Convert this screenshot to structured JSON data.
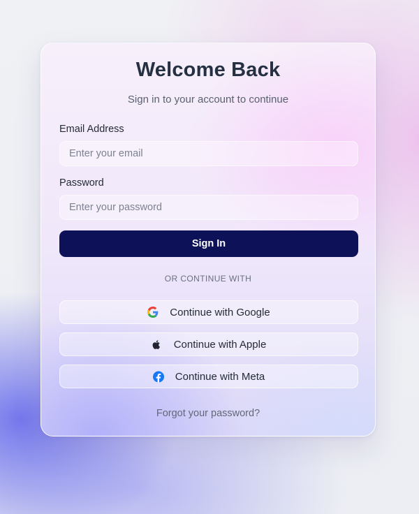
{
  "header": {
    "title": "Welcome Back",
    "subtitle": "Sign in to your account to continue"
  },
  "form": {
    "email_label": "Email Address",
    "email_placeholder": "Enter your email",
    "email_value": "",
    "password_label": "Password",
    "password_placeholder": "Enter your password",
    "password_value": "",
    "submit_label": "Sign In"
  },
  "divider": {
    "text": "OR CONTINUE WITH"
  },
  "social": {
    "google_label": "Continue with Google",
    "apple_label": "Continue with Apple",
    "meta_label": "Continue with Meta",
    "icons": [
      "google-icon",
      "apple-icon",
      "facebook-icon"
    ]
  },
  "footer": {
    "forgot_label": "Forgot your password?"
  },
  "colors": {
    "primary_button": "#0d1258",
    "title_text": "#253043",
    "google_blue": "#4285F4",
    "google_red": "#EA4335",
    "google_yellow": "#FBBC05",
    "google_green": "#34A853",
    "meta_blue": "#1877F2"
  }
}
